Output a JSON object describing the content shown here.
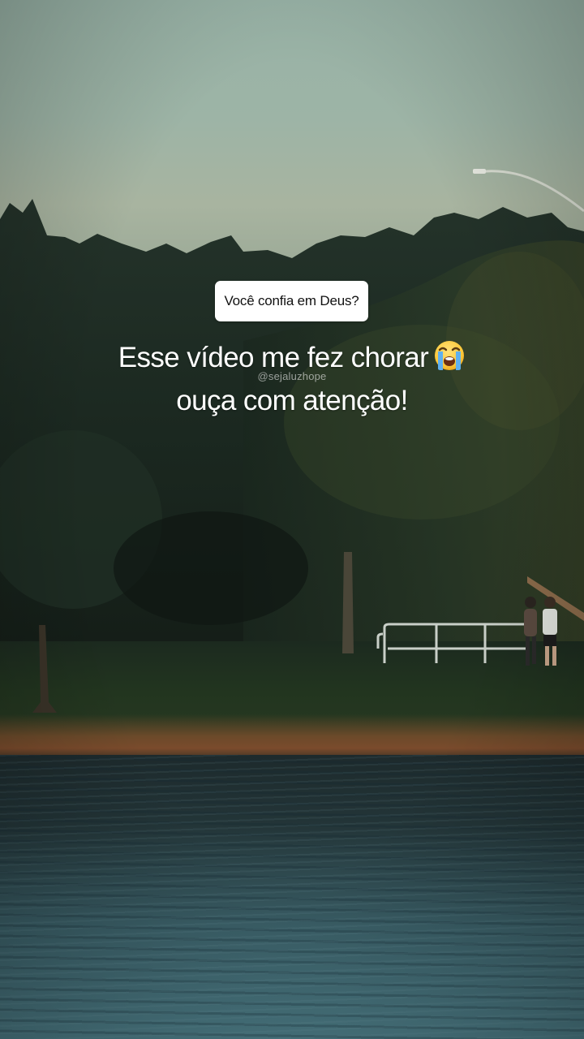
{
  "story": {
    "question_sticker": "Você confia em Deus?",
    "caption_line_1": "Esse vídeo me fez chorar",
    "caption_line_2": "ouça com atenção!",
    "caption_emoji": "loudly-crying-face-icon",
    "watermark": "@sejaluzhope"
  }
}
